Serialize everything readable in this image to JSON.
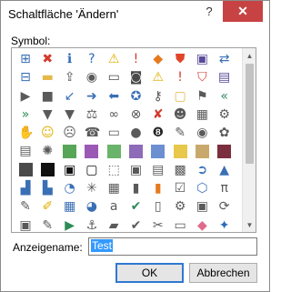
{
  "window": {
    "title": "Schaltfläche 'Ändern'",
    "help_label": "?",
    "close_label": "✕"
  },
  "symbol": {
    "label": "Symbol:"
  },
  "icons": [
    {
      "name": "sitemap-icon",
      "glyph": "⊞",
      "color": "#3a6fb5"
    },
    {
      "name": "error-icon",
      "glyph": "✖",
      "color": "#d23a2b"
    },
    {
      "name": "info-icon",
      "glyph": "ℹ",
      "color": "#2a6ab8"
    },
    {
      "name": "help-circle-icon",
      "glyph": "?",
      "color": "#2a6ab8"
    },
    {
      "name": "warning-icon",
      "glyph": "⚠",
      "color": "#e0b000"
    },
    {
      "name": "exclamation-icon",
      "glyph": "!",
      "color": "#d23a2b"
    },
    {
      "name": "alert-diamond-icon",
      "glyph": "◆",
      "color": "#e57a1f"
    },
    {
      "name": "shield-icon",
      "glyph": "⛊",
      "color": "#e0452a"
    },
    {
      "name": "save-icon",
      "glyph": "▣",
      "color": "#5a4a9a"
    },
    {
      "name": "connect-icon",
      "glyph": "⇄",
      "color": "#3a6fb5"
    },
    {
      "name": "hierarchy-icon",
      "glyph": "⊟",
      "color": "#3a6fb5"
    },
    {
      "name": "folder-icon",
      "glyph": "▬",
      "color": "#e6b84a"
    },
    {
      "name": "upload-icon",
      "glyph": "⇪",
      "color": "#5a5a5a"
    },
    {
      "name": "record-icon",
      "glyph": "◉",
      "color": "#5a5a5a"
    },
    {
      "name": "monitor-icon",
      "glyph": "▭",
      "color": "#4a4a4a"
    },
    {
      "name": "camera-icon",
      "glyph": "◙",
      "color": "#4a4a4a"
    },
    {
      "name": "warning-yellow-icon",
      "glyph": "⚠",
      "color": "#e0b000"
    },
    {
      "name": "alert-icon",
      "glyph": "!",
      "color": "#d23a2b"
    },
    {
      "name": "shield-red-icon",
      "glyph": "⛉",
      "color": "#d23a2b"
    },
    {
      "name": "disk-icon",
      "glyph": "▤",
      "color": "#5a4a9a"
    },
    {
      "name": "play-icon",
      "glyph": "▶",
      "color": "#5a5a5a"
    },
    {
      "name": "stop-icon",
      "glyph": "■",
      "color": "#5a5a5a"
    },
    {
      "name": "arrow-down-left-icon",
      "glyph": "↙",
      "color": "#3a6fb5"
    },
    {
      "name": "arrow-right-icon",
      "glyph": "➜",
      "color": "#3a6fb5"
    },
    {
      "name": "arrow-left-icon",
      "glyph": "⬅",
      "color": "#3a6fb5"
    },
    {
      "name": "pin-icon",
      "glyph": "✪",
      "color": "#3a6fb5"
    },
    {
      "name": "key-icon",
      "glyph": "⚷",
      "color": "#5a5a5a"
    },
    {
      "name": "folder-open-icon",
      "glyph": "▢",
      "color": "#e6b84a"
    },
    {
      "name": "flag-icon",
      "glyph": "⚑",
      "color": "#5a5a5a"
    },
    {
      "name": "rewind-icon",
      "glyph": "«",
      "color": "#2e8b57"
    },
    {
      "name": "forward-icon",
      "glyph": "»",
      "color": "#2e8b57"
    },
    {
      "name": "filter-icon",
      "glyph": "▼",
      "color": "#5a5a5a"
    },
    {
      "name": "sort-icon",
      "glyph": "▼",
      "color": "#5a5a5a"
    },
    {
      "name": "balance-icon",
      "glyph": "⚖",
      "color": "#5a5a5a"
    },
    {
      "name": "link-icon",
      "glyph": "∞",
      "color": "#5a5a5a"
    },
    {
      "name": "binoculars-icon",
      "glyph": "⊗",
      "color": "#5a5a5a"
    },
    {
      "name": "no-phone-icon",
      "glyph": "✘",
      "color": "#d23a2b"
    },
    {
      "name": "person-icon",
      "glyph": "☻",
      "color": "#5a5a5a"
    },
    {
      "name": "table-icon",
      "glyph": "▦",
      "color": "#5a5a5a"
    },
    {
      "name": "settings-icon",
      "glyph": "⚙",
      "color": "#5a5a5a"
    },
    {
      "name": "hand-icon",
      "glyph": "✋",
      "color": "#5a5a5a"
    },
    {
      "name": "smiley-icon",
      "glyph": "☺",
      "color": "#e0b000"
    },
    {
      "name": "sad-icon",
      "glyph": "☹",
      "color": "#5a5a5a"
    },
    {
      "name": "phone-icon",
      "glyph": "☎",
      "color": "#5a5a5a"
    },
    {
      "name": "battery-icon",
      "glyph": "▭",
      "color": "#5a5a5a"
    },
    {
      "name": "piggy-bank-icon",
      "glyph": "●",
      "color": "#5a5a5a"
    },
    {
      "name": "eight-ball-icon",
      "glyph": "❽",
      "color": "#222222"
    },
    {
      "name": "pencil-icon",
      "glyph": "✎",
      "color": "#5a5a5a"
    },
    {
      "name": "eye-icon",
      "glyph": "◉",
      "color": "#5a5a5a"
    },
    {
      "name": "brain-icon",
      "glyph": "✿",
      "color": "#5a5a5a"
    },
    {
      "name": "clipboard-icon",
      "glyph": "▤",
      "color": "#5a5a5a"
    },
    {
      "name": "sun-icon",
      "glyph": "✺",
      "color": "#5a5a5a"
    },
    {
      "name": "green-swatch-icon",
      "swatch": "#57a657"
    },
    {
      "name": "purple-swatch-icon",
      "swatch": "#9b59b6"
    },
    {
      "name": "green-swatch-2-icon",
      "swatch": "#6ab36a"
    },
    {
      "name": "purple-swatch-2-icon",
      "swatch": "#8e6bb8"
    },
    {
      "name": "blue-swatch-icon",
      "swatch": "#6b8fd1"
    },
    {
      "name": "yellow-swatch-icon",
      "swatch": "#e8c84a"
    },
    {
      "name": "tan-swatch-icon",
      "swatch": "#c9a96b"
    },
    {
      "name": "maroon-swatch-icon",
      "swatch": "#7a2e3e"
    },
    {
      "name": "half-black-swatch-icon",
      "swatch": "#4a4a4a"
    },
    {
      "name": "black-swatch-icon",
      "swatch": "#111111"
    },
    {
      "name": "frame-black-icon",
      "glyph": "▣",
      "color": "#111111"
    },
    {
      "name": "frame-thin-icon",
      "glyph": "▢",
      "color": "#111111"
    },
    {
      "name": "dotted-frame-icon",
      "glyph": "⬚",
      "color": "#5a5a5a"
    },
    {
      "name": "frame-top-icon",
      "glyph": "▣",
      "color": "#5a5a5a"
    },
    {
      "name": "frame-bottom-icon",
      "glyph": "▤",
      "color": "#5a5a5a"
    },
    {
      "name": "checker-icon",
      "glyph": "▩",
      "color": "#5a5a5a"
    },
    {
      "name": "circle-right-icon",
      "glyph": "➲",
      "color": "#3a6fb5"
    },
    {
      "name": "triangle-icon",
      "glyph": "▲",
      "color": "#3a6fb5"
    },
    {
      "name": "chart-icon",
      "glyph": "▟",
      "color": "#3a6fb5"
    },
    {
      "name": "chart-2-icon",
      "glyph": "▙",
      "color": "#3a6fb5"
    },
    {
      "name": "pie-icon",
      "glyph": "◔",
      "color": "#3a6fb5"
    },
    {
      "name": "network-icon",
      "glyph": "✳",
      "color": "#5a5a5a"
    },
    {
      "name": "grid-icon",
      "glyph": "▦",
      "color": "#5a5a5a"
    },
    {
      "name": "book-icon",
      "glyph": "▮",
      "color": "#5a5a5a"
    },
    {
      "name": "book-orange-icon",
      "glyph": "▮",
      "color": "#e57a1f"
    },
    {
      "name": "checklist-icon",
      "glyph": "☑",
      "color": "#5a5a5a"
    },
    {
      "name": "cube-icon",
      "glyph": "⬡",
      "color": "#3a6fb5"
    },
    {
      "name": "pi-icon",
      "glyph": "π",
      "color": "#5a5a5a"
    },
    {
      "name": "paint-icon",
      "glyph": "✎",
      "color": "#5a5a5a"
    },
    {
      "name": "brush-icon",
      "glyph": "✐",
      "color": "#e0b000"
    },
    {
      "name": "gallery-icon",
      "glyph": "▦",
      "color": "#3a6fb5"
    },
    {
      "name": "pie-2-icon",
      "glyph": "◕",
      "color": "#3a6fb5"
    },
    {
      "name": "abc-icon",
      "glyph": "a",
      "color": "#5a5a5a"
    },
    {
      "name": "checkmark-icon",
      "glyph": "✔",
      "color": "#2e8b57"
    },
    {
      "name": "document-icon",
      "glyph": "▯",
      "color": "#5a5a5a"
    },
    {
      "name": "gear-icon",
      "glyph": "⚙",
      "color": "#5a5a5a"
    },
    {
      "name": "stamp-icon",
      "glyph": "▣",
      "color": "#5a5a5a"
    },
    {
      "name": "rotate-icon",
      "glyph": "⟳",
      "color": "#5a5a5a"
    },
    {
      "name": "doc-pin-icon",
      "glyph": "▣",
      "color": "#5a5a5a"
    },
    {
      "name": "edit-icon",
      "glyph": "✎",
      "color": "#5a5a5a"
    },
    {
      "name": "play-green-icon",
      "glyph": "▶",
      "color": "#2e8b57"
    },
    {
      "name": "anchor-icon",
      "glyph": "⚓",
      "color": "#5a5a5a"
    },
    {
      "name": "briefcase-icon",
      "glyph": "▰",
      "color": "#5a5a5a"
    },
    {
      "name": "check-red-icon",
      "glyph": "✔",
      "color": "#5a5a5a"
    },
    {
      "name": "clip-icon",
      "glyph": "✂",
      "color": "#5a5a5a"
    },
    {
      "name": "folder-small-icon",
      "glyph": "▭",
      "color": "#5a5a5a"
    },
    {
      "name": "eraser-icon",
      "glyph": "◆",
      "color": "#e06a8a"
    },
    {
      "name": "puzzle-icon",
      "glyph": "✦",
      "color": "#2a6ab8"
    },
    {
      "name": "color-wheel-icon",
      "glyph": "❦",
      "color": "#e57a1f"
    },
    {
      "name": "bell-icon",
      "glyph": "⍾",
      "color": "#5a5a5a"
    },
    {
      "name": "mail-icon",
      "glyph": "✉",
      "color": "#e0b000"
    }
  ],
  "name_field": {
    "label": "Anzeigename:",
    "value": "Test"
  },
  "buttons": {
    "ok": "OK",
    "cancel": "Abbrechen"
  }
}
